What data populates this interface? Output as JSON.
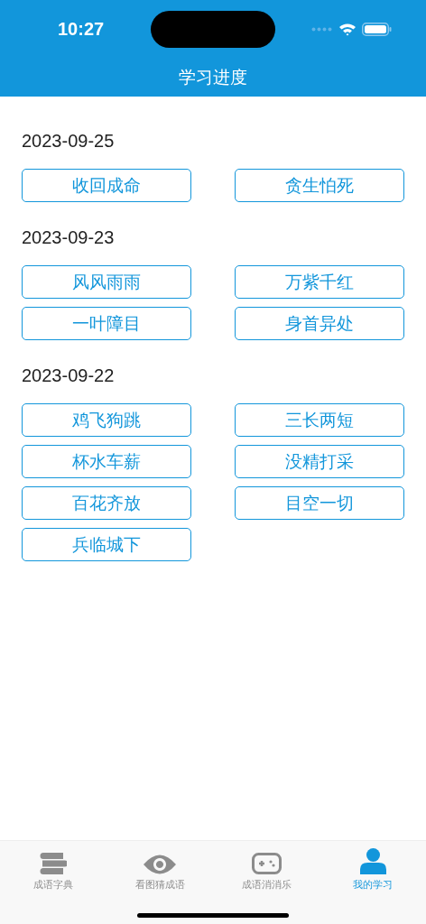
{
  "status_bar": {
    "time": "10:27"
  },
  "nav": {
    "title": "学习进度"
  },
  "sections": [
    {
      "date": "2023-09-25",
      "idioms": [
        "收回成命",
        "贪生怕死"
      ]
    },
    {
      "date": "2023-09-23",
      "idioms": [
        "风风雨雨",
        "万紫千红",
        "一叶障目",
        "身首异处"
      ]
    },
    {
      "date": "2023-09-22",
      "idioms": [
        "鸡飞狗跳",
        "三长两短",
        "杯水车薪",
        "没精打采",
        "百花齐放",
        "目空一切",
        "兵临城下"
      ]
    }
  ],
  "tab_bar": [
    {
      "label": "成语字典",
      "kind": "book",
      "selected": false
    },
    {
      "label": "看图猜成语",
      "kind": "eye",
      "selected": false
    },
    {
      "label": "成语消消乐",
      "kind": "game",
      "selected": false
    },
    {
      "label": "我的学习",
      "kind": "person",
      "selected": true
    }
  ]
}
